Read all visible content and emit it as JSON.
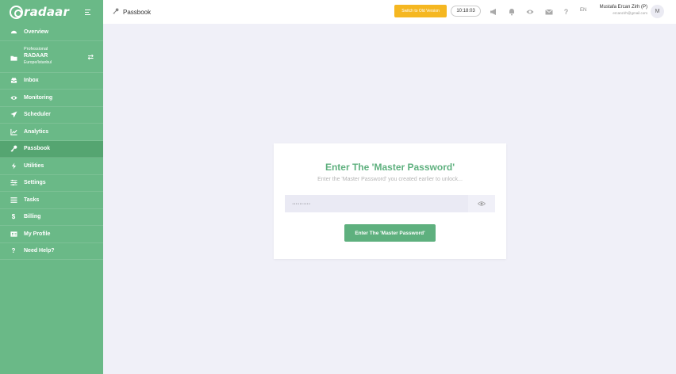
{
  "brand": {
    "name": "radaar"
  },
  "sidebar": {
    "overview": "Overview",
    "workspace": {
      "type": "Professional",
      "name": "RADAAR",
      "location": "Europe/Istanbul"
    },
    "items": [
      {
        "label": "Inbox",
        "icon": "inbox-icon"
      },
      {
        "label": "Monitoring",
        "icon": "eye-icon"
      },
      {
        "label": "Scheduler",
        "icon": "paper-plane-icon"
      },
      {
        "label": "Analytics",
        "icon": "chart-icon"
      },
      {
        "label": "Passbook",
        "icon": "key-icon",
        "active": true
      },
      {
        "label": "Utilities",
        "icon": "bolt-icon"
      },
      {
        "label": "Settings",
        "icon": "sliders-icon"
      },
      {
        "label": "Tasks",
        "icon": "list-icon"
      },
      {
        "label": "Billing",
        "icon": "dollar-icon"
      },
      {
        "label": "My Profile",
        "icon": "id-card-icon"
      },
      {
        "label": "Need Help?",
        "icon": "question-icon"
      }
    ]
  },
  "topbar": {
    "breadcrumb": "Passbook",
    "switch_button": "Switch to Old Version",
    "clock": "10:18:03",
    "language": "EN",
    "user": {
      "name": "Mustafa Ercan Zirh (P)",
      "email": "ercanzirh@gmail.com",
      "initial": "M"
    }
  },
  "card": {
    "title": "Enter The 'Master Password'",
    "subtitle": "Enter the 'Master Password' you created earlier to unlock...",
    "password_value": "··········",
    "button_label": "Enter The 'Master Password'"
  },
  "colors": {
    "primary": "#6ab987",
    "accent": "#5eb07e",
    "warning": "#f5b721",
    "background": "#f0f0f8"
  }
}
